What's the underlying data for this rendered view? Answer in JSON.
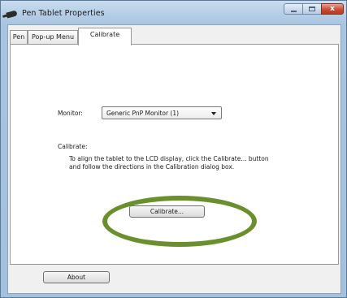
{
  "window": {
    "title": "Pen Tablet Properties"
  },
  "controls": {
    "minimize": "",
    "maximize": "",
    "close": "x"
  },
  "tabs": [
    {
      "label": "Pen",
      "selected": false
    },
    {
      "label": "Pop-up Menu",
      "selected": false
    },
    {
      "label": "Calibrate",
      "selected": true
    }
  ],
  "calibrate": {
    "monitor_label": "Monitor:",
    "monitor_value": "Generic PnP Monitor (1)",
    "section_label": "Calibrate:",
    "description": "To align the tablet to the LCD display, click the Calibrate... button and follow the directions in the Calibration dialog box.",
    "button_label": "Calibrate..."
  },
  "footer": {
    "about_label": "About"
  },
  "colors": {
    "highlight_ring": "#6a8f2d",
    "title_bar": "#b4cde6"
  },
  "icons": {
    "app": "pen-icon",
    "dropdown": "chevron-down-icon"
  }
}
